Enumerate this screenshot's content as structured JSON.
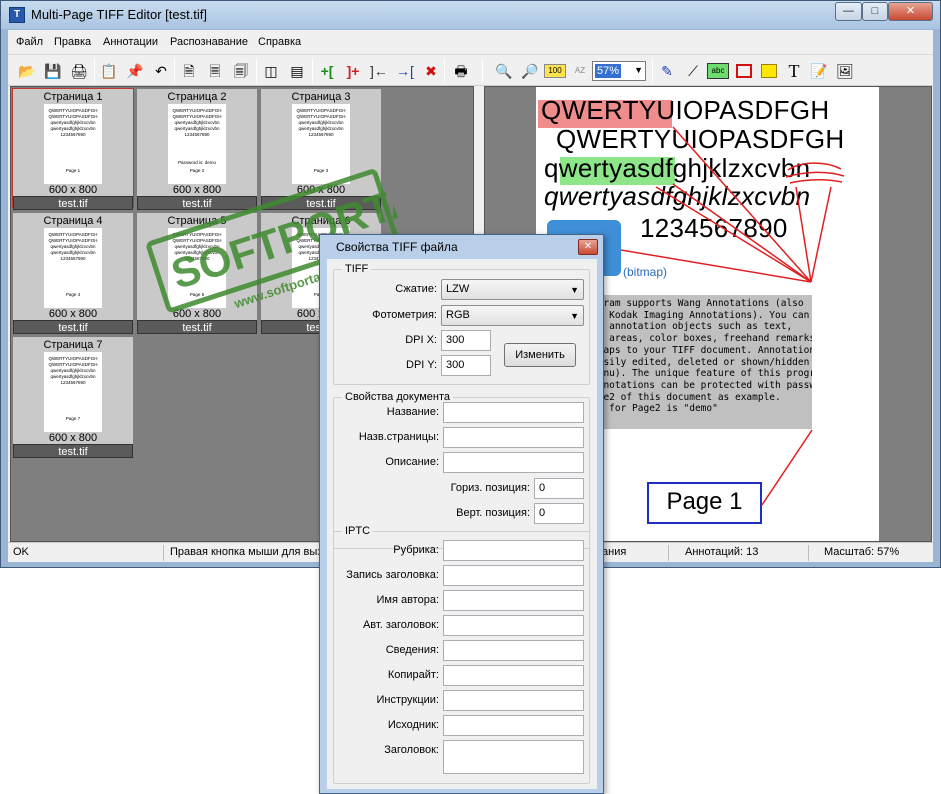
{
  "window": {
    "title": "Multi-Page TIFF Editor [test.tif]",
    "icon": "app-icon",
    "controls": [
      "minimize",
      "maximize",
      "close"
    ]
  },
  "menu": [
    "Файл",
    "Правка",
    "Аннотации",
    "Распознавание",
    "Справка"
  ],
  "toolbar": {
    "icons": [
      "open-icon",
      "save-icon",
      "save-as-icon",
      "copy-icon",
      "paste-icon",
      "undo-icon",
      "page-copy-icon",
      "page-paste-icon",
      "page-paste-special-icon",
      "split-vertical-icon",
      "split-horizontal-icon",
      "insert-before-icon",
      "insert-after-icon",
      "move-left-icon",
      "move-right-icon",
      "delete-icon",
      "scan-icon",
      "zoom-out-icon",
      "zoom-in-icon",
      "zoom-100-icon",
      "zoom-fit-icon",
      "pen-icon",
      "line-icon",
      "text-stamp-icon",
      "rectangle-icon",
      "highlight-icon",
      "text-icon",
      "note-icon",
      "image-icon"
    ],
    "zoom": "57%"
  },
  "thumbnails": [
    {
      "title": "Страница 1",
      "size": "600 x 800",
      "file": "test.tif",
      "page_label": "Page 1",
      "extra": ""
    },
    {
      "title": "Страница 2",
      "size": "600 x 800",
      "file": "test.tif",
      "page_label": "Page 2",
      "extra": "Password is: demo"
    },
    {
      "title": "Страница 3",
      "size": "600 x 800",
      "file": "test.tif",
      "page_label": "Page 3",
      "extra": ""
    },
    {
      "title": "Страница 4",
      "size": "600 x 800",
      "file": "test.tif",
      "page_label": "Page 4",
      "extra": ""
    },
    {
      "title": "Страница 5",
      "size": "600 x 800",
      "file": "test.tif",
      "page_label": "Page 5",
      "extra": ""
    },
    {
      "title": "Страница 6",
      "size": "600 x 800",
      "file": "test.tif",
      "page_label": "Page 6",
      "extra": ""
    },
    {
      "title": "Страница 7",
      "size": "600 x 800",
      "file": "test.tif",
      "page_label": "Page 7",
      "extra": ""
    }
  ],
  "thumb_text": [
    "QWERTYUIOPASDFGH",
    "QWERTYUIOPASDFGH",
    "qwertyasdfghjklzxcvbn",
    "qwertyasdfghjklzxcvbn",
    "1234567890"
  ],
  "document": {
    "line1": "QWERTYUIOPASDFGH",
    "line2": "QWERTYUIOPASDFGH",
    "line3": "qwertyasdfghjklzxcvbn",
    "line4": "qwertyasdfghjklzxcvbn",
    "line5": "1234567890",
    "bitmap_label": "(bitmap)",
    "note_lines": [
      "ogram supports Wang Annotations (also",
      "as Kodak Imaging Annotations). You can",
      "dd annotation objects such as text,",
      "ht areas, color boxes, freehand remarks and",
      "tmaps to your TIFF document. Annotations",
      "easily edited, deleted or shown/hidden (see",
      " menu). The unique feature of this program",
      "annotations can be protected with password",
      "age2 of this document as example.",
      "rd for Page2 is \"demo\""
    ],
    "page_label": "Page 1"
  },
  "status": {
    "state": "OK",
    "hint": "Правая кнопка мыши для выз",
    "hint_tail": "ания",
    "annotations": "Аннотаций: 13",
    "scale": "Масштаб: 57%"
  },
  "dialog": {
    "title": "Свойства TIFF файла",
    "tiff_group": "TIFF",
    "compression_label": "Сжатие:",
    "compression_value": "LZW",
    "photometric_label": "Фотометрия:",
    "photometric_value": "RGB",
    "dpi_x_label": "DPI X:",
    "dpi_x_value": "300",
    "dpi_y_label": "DPI Y:",
    "dpi_y_value": "300",
    "change_button": "Изменить",
    "doc_group": "Свойства документа",
    "doc_fields": [
      {
        "label": "Название:",
        "value": ""
      },
      {
        "label": "Назв.страницы:",
        "value": ""
      },
      {
        "label": "Описание:",
        "value": ""
      }
    ],
    "hpos_label": "Гориз. позиция:",
    "hpos_value": "0",
    "vpos_label": "Верт. позиция:",
    "vpos_value": "0",
    "iptc_group": "IPTC",
    "iptc_fields": [
      {
        "label": "Рубрика:",
        "value": ""
      },
      {
        "label": "Запись заголовка:",
        "value": ""
      },
      {
        "label": "Имя автора:",
        "value": ""
      },
      {
        "label": "Авт. заголовок:",
        "value": ""
      },
      {
        "label": "Сведения:",
        "value": ""
      },
      {
        "label": "Копирайт:",
        "value": ""
      },
      {
        "label": "Инструкции:",
        "value": ""
      },
      {
        "label": "Исходник:",
        "value": ""
      },
      {
        "label": "Заголовок:",
        "value": ""
      }
    ]
  },
  "watermark": {
    "brand": "SOFTPORTAL",
    "url": "www.softportal.com"
  },
  "colors": {
    "accent": "#3470d0",
    "selection_border": "#c0392b",
    "highlight_red": "#ef8d8d",
    "highlight_green": "#8ee68a",
    "annotation_line": "#e02020",
    "label_border": "#1c2fc0",
    "watermark": "#3f8a2f"
  }
}
